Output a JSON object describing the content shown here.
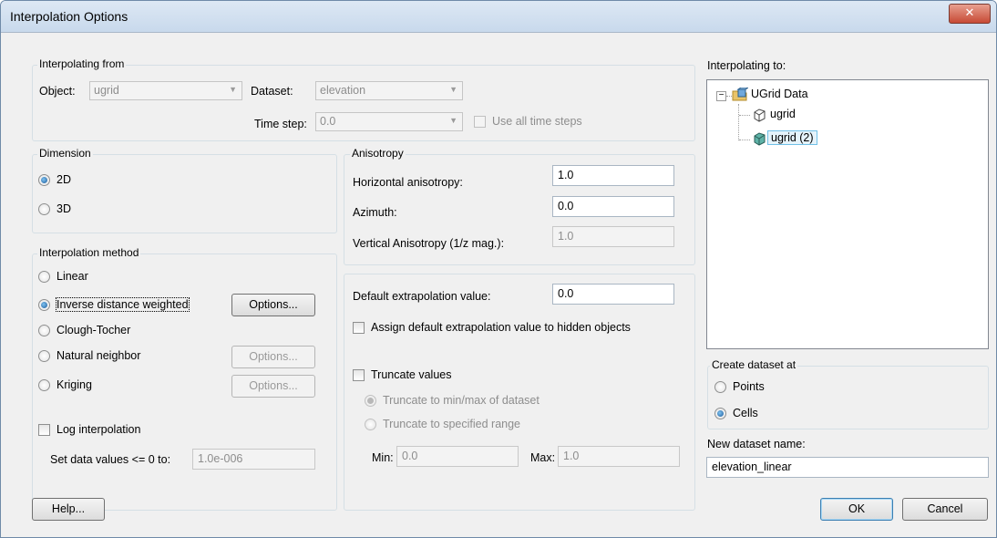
{
  "window": {
    "title": "Interpolation Options",
    "close_glyph": "✕"
  },
  "from": {
    "group_label": "Interpolating from",
    "object_label": "Object:",
    "object_value": "ugrid",
    "dataset_label": "Dataset:",
    "dataset_value": "elevation",
    "timestep_label": "Time step:",
    "timestep_value": "0.0",
    "use_all_label": "Use all time steps"
  },
  "dimension": {
    "group_label": "Dimension",
    "options": [
      "2D",
      "3D"
    ],
    "selected": "2D"
  },
  "anisotropy": {
    "group_label": "Anisotropy",
    "horizontal_label": "Horizontal anisotropy:",
    "horizontal_value": "1.0",
    "azimuth_label": "Azimuth:",
    "azimuth_value": "0.0",
    "vertical_label": "Vertical Anisotropy (1/z mag.):",
    "vertical_value": "1.0"
  },
  "method": {
    "group_label": "Interpolation method",
    "options": [
      "Linear",
      "Inverse distance weighted",
      "Clough-Tocher",
      "Natural neighbor",
      "Kriging"
    ],
    "selected": "Inverse distance weighted",
    "options_button": "Options...",
    "log_label": "Log interpolation",
    "set_data_label": "Set data values <= 0 to:",
    "set_data_value": "1.0e-006"
  },
  "extrap": {
    "default_label": "Default extrapolation value:",
    "default_value": "0.0",
    "assign_label": "Assign default extrapolation value to hidden objects",
    "truncate_label": "Truncate values",
    "trunc_minmax": "Truncate to min/max of dataset",
    "trunc_range": "Truncate to specified range",
    "min_label": "Min:",
    "min_value": "0.0",
    "max_label": "Max:",
    "max_value": "1.0"
  },
  "to": {
    "label": "Interpolating to:",
    "tree": {
      "root": "UGrid Data",
      "children": [
        "ugrid",
        "ugrid (2)"
      ],
      "selected": "ugrid (2)"
    },
    "expander": "−"
  },
  "create": {
    "group_label": "Create dataset at",
    "options": [
      "Points",
      "Cells"
    ],
    "selected": "Cells"
  },
  "name": {
    "label": "New dataset name:",
    "value": "elevation_linear"
  },
  "buttons": {
    "help": "Help...",
    "ok": "OK",
    "cancel": "Cancel"
  }
}
